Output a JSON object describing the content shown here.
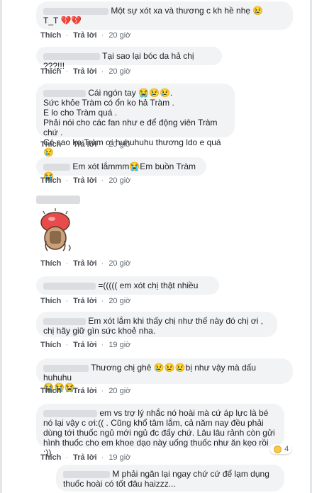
{
  "actions": {
    "like": "Thích",
    "reply": "Trả lời",
    "dot": "·"
  },
  "comments": [
    {
      "text": "Một sự xót xa và thương c kh hề nhẹ 😢\nT_T 💔💔",
      "time": "20 giờ"
    },
    {
      "text": "Tại sao lại bóc da hả chị ???!!!",
      "time": "20 giờ"
    },
    {
      "text": "Cái ngón tay 😭😢😢.\nSức khỏe Tràm có ổn ko hả Tràm .\nE lo cho Tràm quá .\nPhải nói cho các fan như e để động viên Tràm chứ .\nCó sao ko Tràm ơi huhuhuhu thương ldo e quá 😢",
      "time": "20 giờ"
    },
    {
      "text": "Em xót lắmmm😭Em buồn Tràm😭",
      "time": "20 giờ"
    },
    {
      "text": "",
      "time": "20 giờ",
      "sticker": true
    },
    {
      "text": "=((((( em xót chị thật nhiều",
      "time": "20 giờ"
    },
    {
      "text": "Em xót lắm khi thấy chị như thế này đó chị ơi , chị hãy giữ gìn sức khoẻ nha.",
      "time": "19 giờ"
    },
    {
      "text": "Thương chị ghê 😢😢😢bị như vậy mà dấu huhuhu\n😭😭😭",
      "time": "20 giờ"
    },
    {
      "text": "em vs trợ lý nhắc nó hoài mà cứ áp lực là bé nó lại vậy c ơi:(( . Cũng khổ tâm lắm, cả năm nay đều phải dùng tới thuốc ngủ mới ngủ đc đấy chứ. Lâu lâu rảnh còn gửi hình thuốc cho em khoe dạo này uống thuốc như ăn kẹo rồi :))",
      "time": "19 giờ",
      "reactions": "4"
    },
    {
      "text": "M phải ngăn lại ngay chứ cứ để lạm dụng thuốc hoài có tốt đâu haizzz...",
      "time": ""
    }
  ],
  "colors": {
    "bubble": "#f2f3f5",
    "link": "#4b4f56",
    "meta": "#606770"
  },
  "icons": {
    "avatar": "blurred-avatar",
    "emoji": "sad-face-icon",
    "sticker": "crying-character-sticker"
  }
}
